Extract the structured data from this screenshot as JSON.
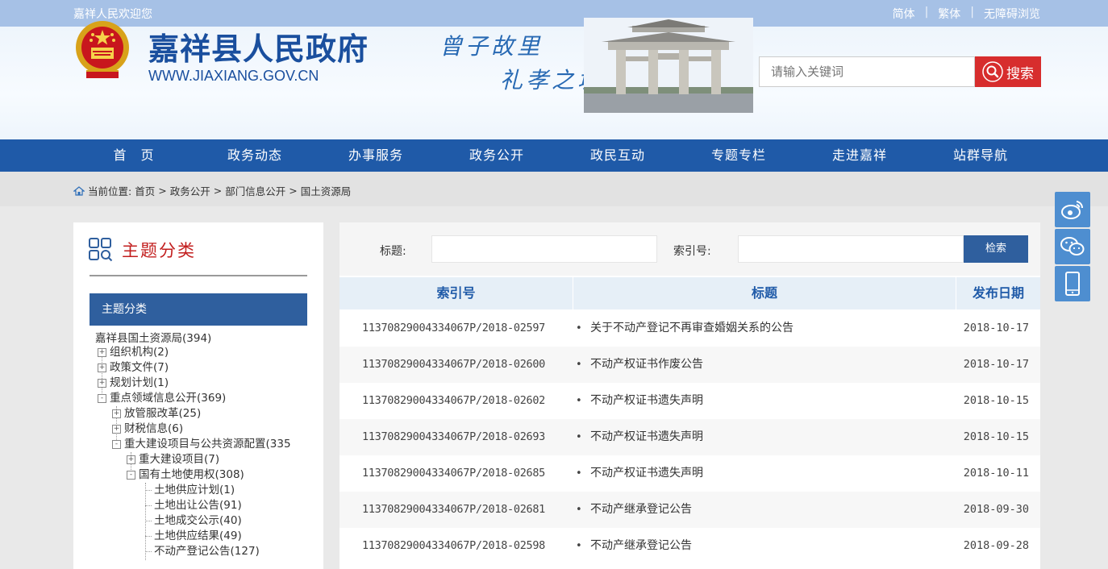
{
  "topbar": {
    "welcome": "嘉祥人民欢迎您",
    "lang_simple": "简体",
    "lang_traditional": "繁体",
    "accessibility": "无障碍浏览",
    "separator": "|"
  },
  "header": {
    "site_name": "嘉祥县人民政府",
    "site_url": "WWW.JIAXIANG.GOV.CN",
    "slogan_line1": "曾子故里",
    "slogan_line2": "礼孝之城",
    "search_placeholder": "请输入关键词",
    "search_button": "搜索"
  },
  "nav": {
    "items": [
      "首　页",
      "政务动态",
      "办事服务",
      "政务公开",
      "政民互动",
      "专题专栏",
      "走进嘉祥",
      "站群导航"
    ]
  },
  "breadcrumb": {
    "prefix": "当前位置:",
    "path": [
      "首页",
      "政务公开",
      "部门信息公开",
      "国土资源局"
    ],
    "sep": ">"
  },
  "left_panel": {
    "title": "主题分类",
    "active_item": "主题分类",
    "tree": [
      {
        "label": "嘉祥县国土资源局(394)"
      },
      {
        "label": "组织机构(2)",
        "toggle": "+"
      },
      {
        "label": "政策文件(7)",
        "toggle": "+"
      },
      {
        "label": "规划计划(1)",
        "toggle": "+"
      },
      {
        "label": "重点领域信息公开(369)",
        "toggle": "-"
      },
      {
        "label": "放管服改革(25)",
        "toggle": "+"
      },
      {
        "label": "财税信息(6)",
        "toggle": "+"
      },
      {
        "label": "重大建设项目与公共资源配置(335",
        "toggle": "-"
      },
      {
        "label": "重大建设项目(7)",
        "toggle": "+"
      },
      {
        "label": "国有土地使用权(308)",
        "toggle": "-"
      },
      {
        "label": "土地供应计划(1)"
      },
      {
        "label": "土地出让公告(91)"
      },
      {
        "label": "土地成交公示(40)"
      },
      {
        "label": "土地供应结果(49)"
      },
      {
        "label": "不动产登记公告(127)"
      }
    ]
  },
  "filter": {
    "title_label": "标题:",
    "index_label": "索引号:",
    "search_button": "检索"
  },
  "table": {
    "headers": [
      "索引号",
      "标题",
      "发布日期"
    ],
    "bullet": "•",
    "rows": [
      {
        "index": "11370829004334067P/2018-02597",
        "title": "关于不动产登记不再审查婚姻关系的公告",
        "date": "2018-10-17"
      },
      {
        "index": "11370829004334067P/2018-02600",
        "title": "不动产权证书作废公告",
        "date": "2018-10-17"
      },
      {
        "index": "11370829004334067P/2018-02602",
        "title": "不动产权证书遗失声明",
        "date": "2018-10-15"
      },
      {
        "index": "11370829004334067P/2018-02693",
        "title": "不动产权证书遗失声明",
        "date": "2018-10-15"
      },
      {
        "index": "11370829004334067P/2018-02685",
        "title": "不动产权证书遗失声明",
        "date": "2018-10-11"
      },
      {
        "index": "11370829004334067P/2018-02681",
        "title": "不动产继承登记公告",
        "date": "2018-09-30"
      },
      {
        "index": "11370829004334067P/2018-02598",
        "title": "不动产继承登记公告",
        "date": "2018-09-28"
      }
    ]
  },
  "float_icons": [
    "weibo-icon",
    "wechat-icon",
    "mobile-icon"
  ],
  "colors": {
    "brand_blue": "#1f5aa8",
    "search_red": "#d72d2d",
    "title_red": "#c21e1e",
    "topbar": "#a6c1e6"
  }
}
